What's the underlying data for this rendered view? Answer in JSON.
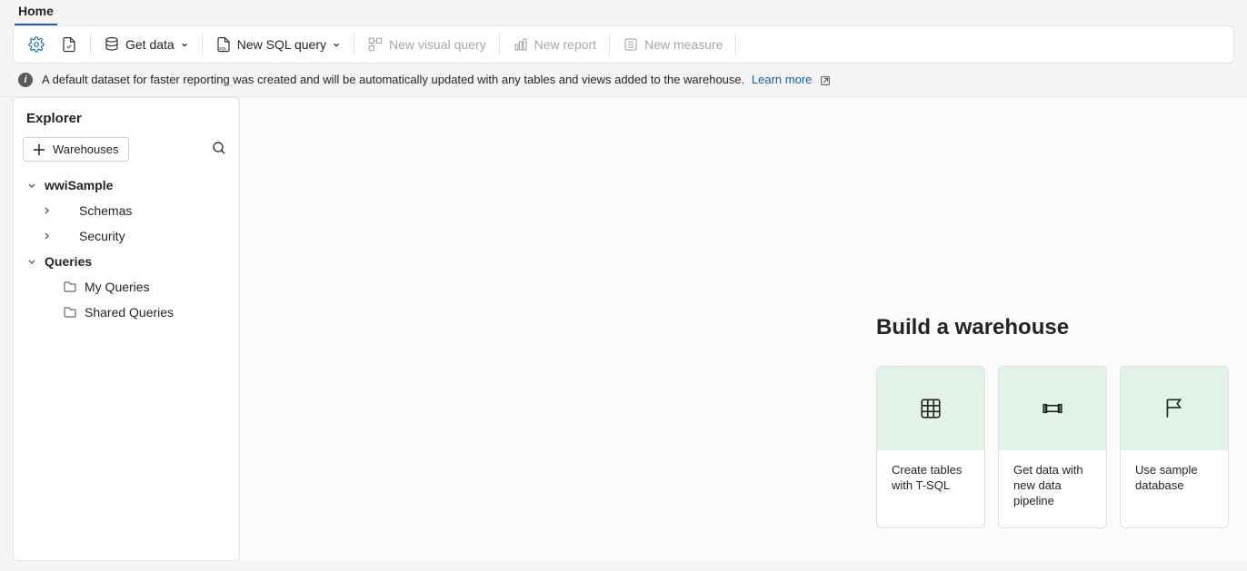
{
  "tabs": {
    "home": "Home"
  },
  "toolbar": {
    "get_data": "Get data",
    "new_sql_query": "New SQL query",
    "new_visual_query": "New visual query",
    "new_report": "New report",
    "new_measure": "New measure"
  },
  "info": {
    "text": "A default dataset for faster reporting was created and will be automatically updated with any tables and views added to the warehouse.",
    "learn_more": "Learn more"
  },
  "explorer": {
    "title": "Explorer",
    "add_warehouses": "Warehouses",
    "tree": {
      "warehouse": "wwiSample",
      "schemas": "Schemas",
      "security": "Security",
      "queries": "Queries",
      "my_queries": "My Queries",
      "shared_queries": "Shared Queries"
    }
  },
  "main": {
    "build_title": "Build a warehouse",
    "cards": {
      "create_tables": "Create tables with T-SQL",
      "get_data_pipeline": "Get data with new data pipeline",
      "use_sample": "Use sample database"
    }
  }
}
